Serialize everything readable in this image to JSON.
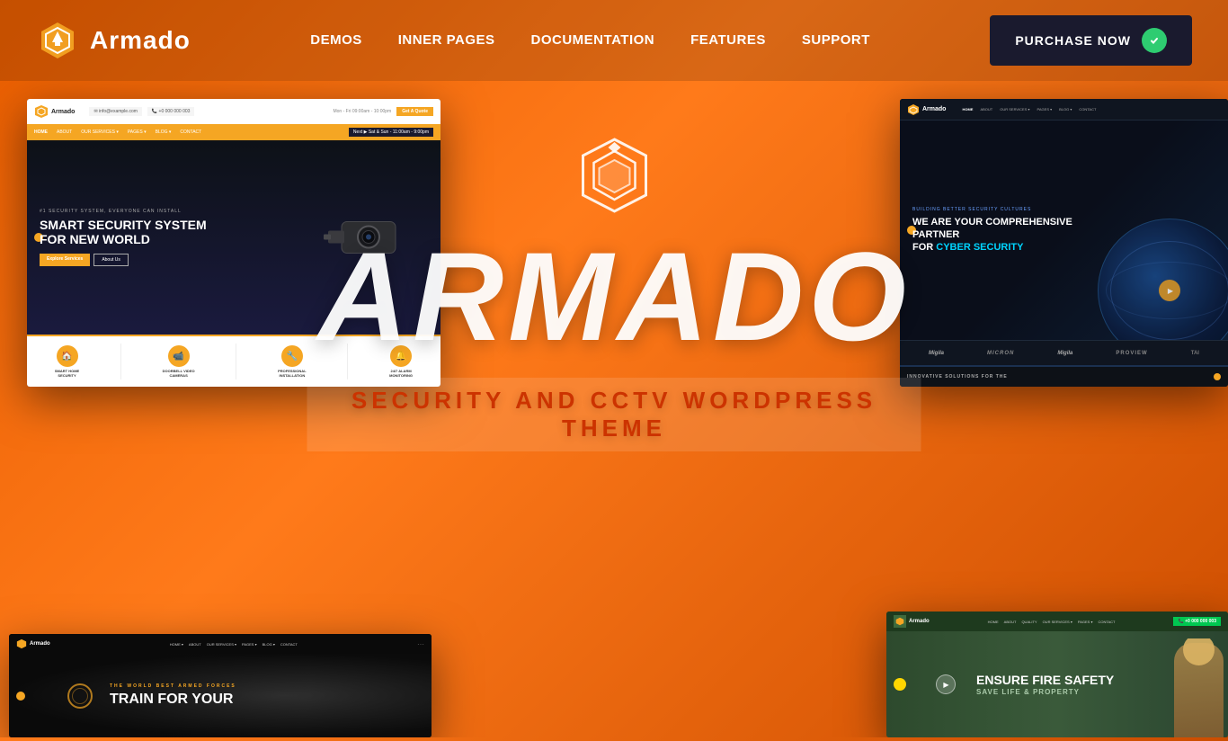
{
  "navbar": {
    "logo_text": "Armado",
    "nav_items": [
      {
        "label": "DEMOS",
        "href": "#"
      },
      {
        "label": "INNER PAGES",
        "href": "#"
      },
      {
        "label": "DOCUMENTATION",
        "href": "#"
      },
      {
        "label": "FEATURES",
        "href": "#"
      },
      {
        "label": "SUPPORT",
        "href": "#"
      }
    ],
    "purchase_button": "PURCHASE NOW"
  },
  "hero": {
    "brand_name": "ARMADO",
    "subtitle": "SECURITY AND CCTV WORDPRESS THEME"
  },
  "demos": {
    "top_left": {
      "theme": "Security Home",
      "header_email": "info@example.com",
      "header_phone": "+0 000 000 003",
      "cta": "Get A Quote",
      "tagline": "#1 SECURITY SYSTEM, EVERYONE CAN INSTALL",
      "title_line1": "SMART SECURITY SYSTEM",
      "title_line2": "FOR NEW WORLD",
      "btn1": "Explore Services",
      "btn2": "About Us",
      "services": [
        {
          "icon": "🏠",
          "label": "SMART HOME SECURITY"
        },
        {
          "icon": "📹",
          "label": "DOORBELL VIDEO CAMERAS"
        },
        {
          "icon": "🔧",
          "label": "PROFESSIONAL INSTALLATION"
        },
        {
          "icon": "🔔",
          "label": "24/7 ALARM MONITORING"
        }
      ]
    },
    "top_right": {
      "theme": "Cyber Security",
      "tagline": "BUILDING BETTER SECURITY CULTURES",
      "title_line1": "WE ARE YOUR COMPREHENSIVE PARTNER",
      "title_line2": "FOR",
      "highlight": "CYBER SECURITY",
      "partners": [
        "Migila",
        "Micron",
        "Migila",
        "ProView",
        "TAI"
      ],
      "bottom_label": "INNOVATIVE SOLUTIONS FOR THE"
    },
    "bottom_left": {
      "theme": "Armed Forces",
      "tagline": "THE WORLD BEST ARMED FORCES",
      "title_line1": "TRAIN FOR YOUR"
    },
    "bottom_right": {
      "theme": "Fire Safety",
      "title_line1": "Ensure Fire Safety",
      "subtitle": "SAVE LIFE & PROPERTY"
    }
  },
  "colors": {
    "orange": "#e85d00",
    "orange_light": "#ff7a1a",
    "gold": "#f5a623",
    "dark": "#1a1a2e",
    "white": "#ffffff",
    "red_subtitle": "#cc3300",
    "cyber_blue": "#00d4ff",
    "fire_green": "#2d4a2d"
  }
}
